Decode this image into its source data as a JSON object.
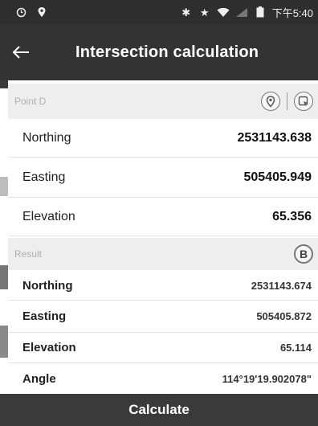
{
  "status_bar": {
    "time": "下午5:40",
    "icons": [
      "alarm-icon",
      "location-icon",
      "bluetooth-icon",
      "star-icon",
      "wifi-icon",
      "signal-icon",
      "battery-icon"
    ]
  },
  "header": {
    "title": "Intersection calculation",
    "back_icon": "arrow-left-icon"
  },
  "point_section": {
    "title": "Point D",
    "icons": [
      "location-pin-icon",
      "select-point-icon"
    ],
    "rows": [
      {
        "label": "Northing",
        "value": "2531143.638"
      },
      {
        "label": "Easting",
        "value": "505405.949"
      },
      {
        "label": "Elevation",
        "value": "65.356"
      }
    ]
  },
  "result_section": {
    "title": "Result",
    "icon": "b-circle-icon",
    "button_letter": "B",
    "rows": [
      {
        "label": "Northing",
        "value": "2531143.674"
      },
      {
        "label": "Easting",
        "value": "505405.872"
      },
      {
        "label": "Elevation",
        "value": "65.114"
      },
      {
        "label": "Angle",
        "value": "114°19'19.902078\""
      }
    ]
  },
  "actions": {
    "calculate_label": "Calculate"
  },
  "colors": {
    "app_bar": "#333333",
    "status_bar": "#2e2e2e",
    "section_header": "#eeeeee",
    "button": "#3a3a3a"
  }
}
